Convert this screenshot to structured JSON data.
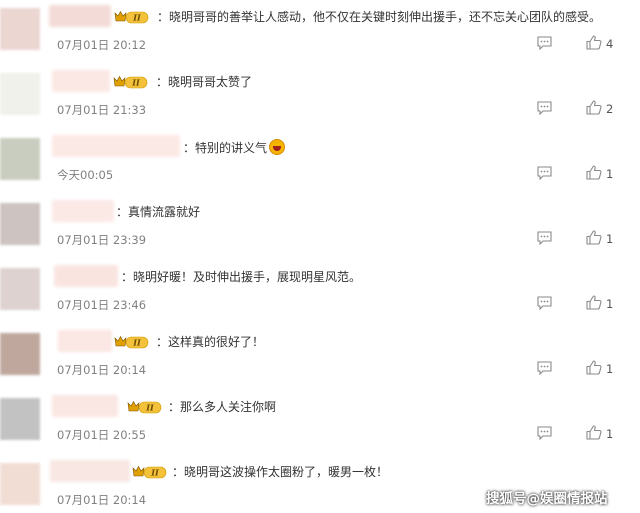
{
  "comments": [
    {
      "text": "：晓明哥哥的善举让人感动，他不仅在关键时刻伸出援手，还不忘关心团队的感受。",
      "time": "07月01日 20:12",
      "likes": "4",
      "badge": true
    },
    {
      "text": "：晓明哥哥太赞了",
      "time": "07月01日 21:33",
      "likes": "2",
      "badge": true
    },
    {
      "text": "：特别的讲义气",
      "time": "今天00:05",
      "likes": "1",
      "badge": false,
      "emoji": "laughing-emoji"
    },
    {
      "text": "：真情流露就好",
      "time": "07月01日 23:39",
      "likes": "1",
      "badge": false
    },
    {
      "text": "：晓明好暖！及时伸出援手，展现明星风范。",
      "time": "07月01日 23:46",
      "likes": "1",
      "badge": false
    },
    {
      "text": "：这样真的很好了！",
      "time": "07月01日 20:14",
      "likes": "1",
      "badge": true
    },
    {
      "text": "：那么多人关注你啊",
      "time": "07月01日 20:55",
      "likes": "1",
      "badge": true
    },
    {
      "text": "：晓明哥这波操作太圈粉了，暖男一枚！",
      "time": "07月01日 20:14",
      "likes": "",
      "badge": true
    }
  ],
  "badge_label": "II",
  "watermark": "搜狐号@娱圈情报站",
  "colors": {
    "badge_gold": "#e0a100",
    "badge_dark": "#3a2a10",
    "icon_gray": "#8a8a8a"
  }
}
